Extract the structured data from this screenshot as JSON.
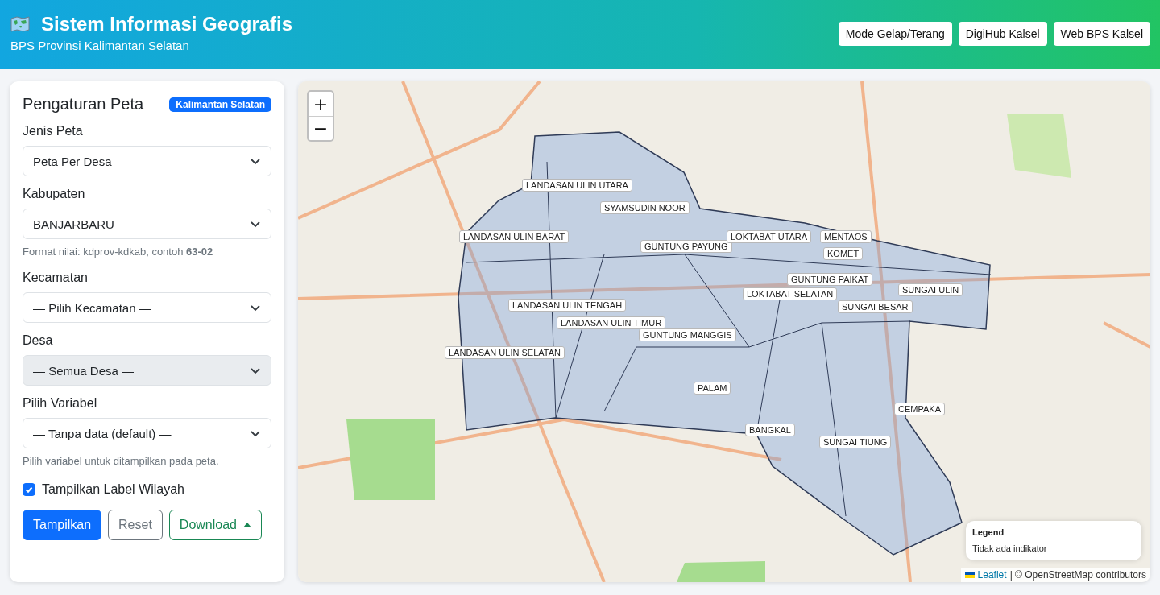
{
  "header": {
    "title": "Sistem Informasi Geografis",
    "subtitle": "BPS Provinsi Kalimantan Selatan",
    "buttons": [
      "Mode Gelap/Terang",
      "DigiHub Kalsel",
      "Web BPS Kalsel"
    ]
  },
  "settings": {
    "title": "Pengaturan Peta",
    "badge": "Kalimantan Selatan",
    "fields": [
      {
        "label": "Jenis Peta",
        "value": "Peta Per Desa",
        "disabled": false
      },
      {
        "label": "Kabupaten",
        "value": "BANJARBARU",
        "disabled": false,
        "help": "Format nilai: kdprov-kdkab, contoh **63-02**"
      },
      {
        "label": "Kecamatan",
        "value": "— Pilih Kecamatan —",
        "disabled": false
      },
      {
        "label": "Desa",
        "value": "— Semua Desa —",
        "disabled": true
      },
      {
        "label": "Pilih Variabel",
        "value": "— Tanpa data (default) —",
        "disabled": false,
        "help": "Pilih variabel untuk ditampilkan pada peta."
      }
    ],
    "checkbox": {
      "label": "Tampilkan Label Wilayah",
      "checked": true
    },
    "buttons": [
      {
        "label": "Tampilkan",
        "kind": "primary"
      },
      {
        "label": "Reset",
        "kind": "secondary"
      },
      {
        "label": "Download",
        "kind": "dropdown"
      }
    ]
  },
  "map": {
    "zoom_in": "+",
    "zoom_out": "−",
    "labels": [
      "LANDASAN ULIN UTARA",
      "SYAMSUDIN NOOR",
      "LANDASAN ULIN BARAT",
      "GUNTUNG PAYUNG",
      "LOKTABAT UTARA",
      "MENTAOS",
      "KOMET",
      "GUNTUNG PAIKAT",
      "SUNGAI BESAR",
      "SUNGAI ULIN",
      "LOKTABAT SELATAN",
      "LANDASAN ULIN TENGAH",
      "LANDASAN ULIN TIMUR",
      "GUNTUNG MANGGIS",
      "LANDASAN ULIN SELATAN",
      "PALAM",
      "CEMPAKA",
      "BANGKAL",
      "SUNGAI TIUNG"
    ],
    "legend": {
      "title": "Legend",
      "text": "Tidak ada indikator"
    },
    "attribution": {
      "link": "Leaflet",
      "text": "| © OpenStreetMap contributors"
    }
  }
}
